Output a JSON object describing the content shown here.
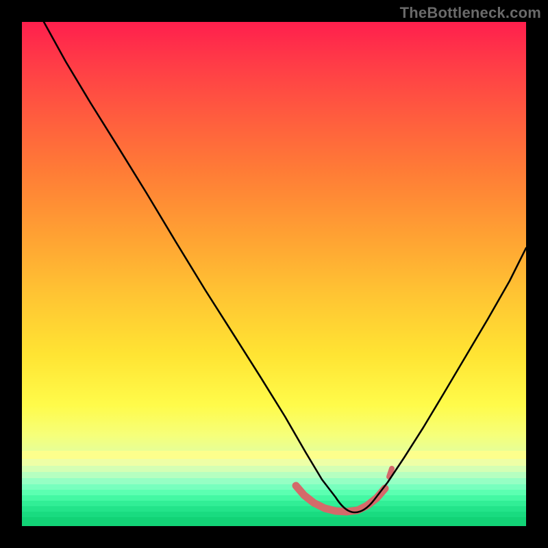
{
  "watermark": {
    "text": "TheBottleneck.com"
  },
  "chart_data": {
    "type": "line",
    "title": "",
    "xlabel": "",
    "ylabel": "",
    "xlim": [
      0,
      100
    ],
    "ylim": [
      0,
      100
    ],
    "series": [
      {
        "name": "bottleneck-curve",
        "x": [
          0,
          5,
          10,
          15,
          20,
          25,
          30,
          35,
          40,
          45,
          50,
          55,
          60,
          62,
          64,
          66,
          68,
          70,
          73,
          76,
          80,
          84,
          88,
          92,
          96,
          100
        ],
        "values": [
          100,
          92,
          84,
          76,
          68,
          59,
          50,
          41,
          32,
          24,
          16,
          10,
          5,
          3,
          2,
          2,
          2,
          3,
          5,
          9,
          14,
          21,
          29,
          37,
          46,
          55
        ]
      }
    ],
    "highlight_region": {
      "x_start": 55,
      "x_end": 72,
      "color": "#d46a6a"
    }
  },
  "colors": {
    "curve": "#000000",
    "highlight": "#d46a6a",
    "background_top": "#ff1f4d",
    "background_bottom": "#12d67a",
    "frame": "#000000"
  }
}
